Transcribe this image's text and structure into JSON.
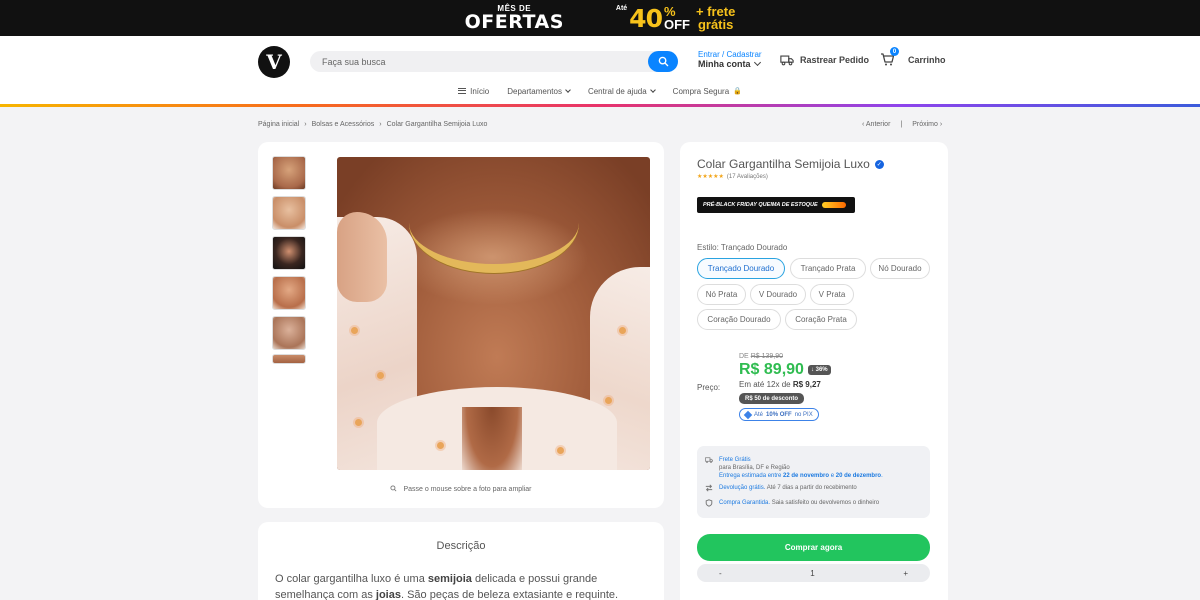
{
  "promo": {
    "small": "MÊS DE",
    "big": "OFERTAS",
    "ate": "Até",
    "percent": "40",
    "pct_sign": "%",
    "off": "OFF",
    "frete_plus": "+ frete",
    "gratis": "grátis"
  },
  "header": {
    "search_placeholder": "Faça sua busca",
    "login": "Entrar / Cadastrar",
    "my_account": "Minha conta",
    "track_order": "Rastrear Pedido",
    "cart_label": "Carrinho",
    "cart_count": "0",
    "logo_letter": "V"
  },
  "nav": {
    "items": [
      "Início",
      "Departamentos",
      "Central de ajuda",
      "Compra Segura"
    ]
  },
  "breadcrumb": {
    "items": [
      "Página inicial",
      "Bolsas e Acessórios",
      "Colar Gargantilha Semijoia Luxo"
    ],
    "sep": "›",
    "prev": "‹ Anterior",
    "divider": "|",
    "next": "Próximo ›"
  },
  "gallery": {
    "zoom_hint": "Passe o mouse sobre a foto para ampliar"
  },
  "description": {
    "title": "Descrição",
    "text_1": "O colar gargantilha luxo é uma ",
    "bold_1": "semijoia",
    "text_2": " delicada e possui grande semelhança com as ",
    "bold_2": "joias",
    "text_3": ". São peças de beleza extasiante e requinte."
  },
  "product": {
    "title": "Colar Gargantilha Semijoia Luxo",
    "stars": "★★★★★",
    "reviews": "(17 Avaliações)",
    "badge": "PRÉ-BLACK FRIDAY QUEIMA DE ESTOQUE",
    "style_label": "Estilo: Trançado Dourado",
    "variants": [
      "Trançado Dourado",
      "Trançado Prata",
      "Nó Dourado",
      "Nó Prata",
      "V Dourado",
      "V Prata",
      "Coração Dourado",
      "Coração Prata"
    ],
    "selected_variant": "Trançado Dourado",
    "price_label": "Preço:",
    "old_price_prefix": "DE",
    "old_price": "R$ 139,90",
    "price": "R$ 89,90",
    "discount_pct": "↓ 36%",
    "installment_prefix": "Em até 12x de",
    "installment_value": "R$ 9,27",
    "discount_badge": "R$ 50 de desconto",
    "pix_prefix": "Até",
    "pix_bold": "10% OFF",
    "pix_suffix": "no PIX"
  },
  "shipping": {
    "frete_title": "Frete Grátis",
    "frete_region": "para Brasília, DF e Região",
    "delivery_prefix": "Entrega estimada entre",
    "date_1": "22 de novembro",
    "date_and": "e",
    "date_2": "20 de dezembro",
    "return_title": "Devolução grátis.",
    "return_text": "Até 7 dias a partir do recebimento",
    "guarantee_title": "Compra Garantida.",
    "guarantee_text": "Saia satisfeito ou devolvemos o dinheiro"
  },
  "actions": {
    "buy": "Comprar agora",
    "minus": "-",
    "qty": "1",
    "plus": "+"
  },
  "colors": {
    "accent": "#0a84ff",
    "price_green": "#2fbc50",
    "buy_button": "#22c55e",
    "promo_yellow": "#f7c21b"
  }
}
